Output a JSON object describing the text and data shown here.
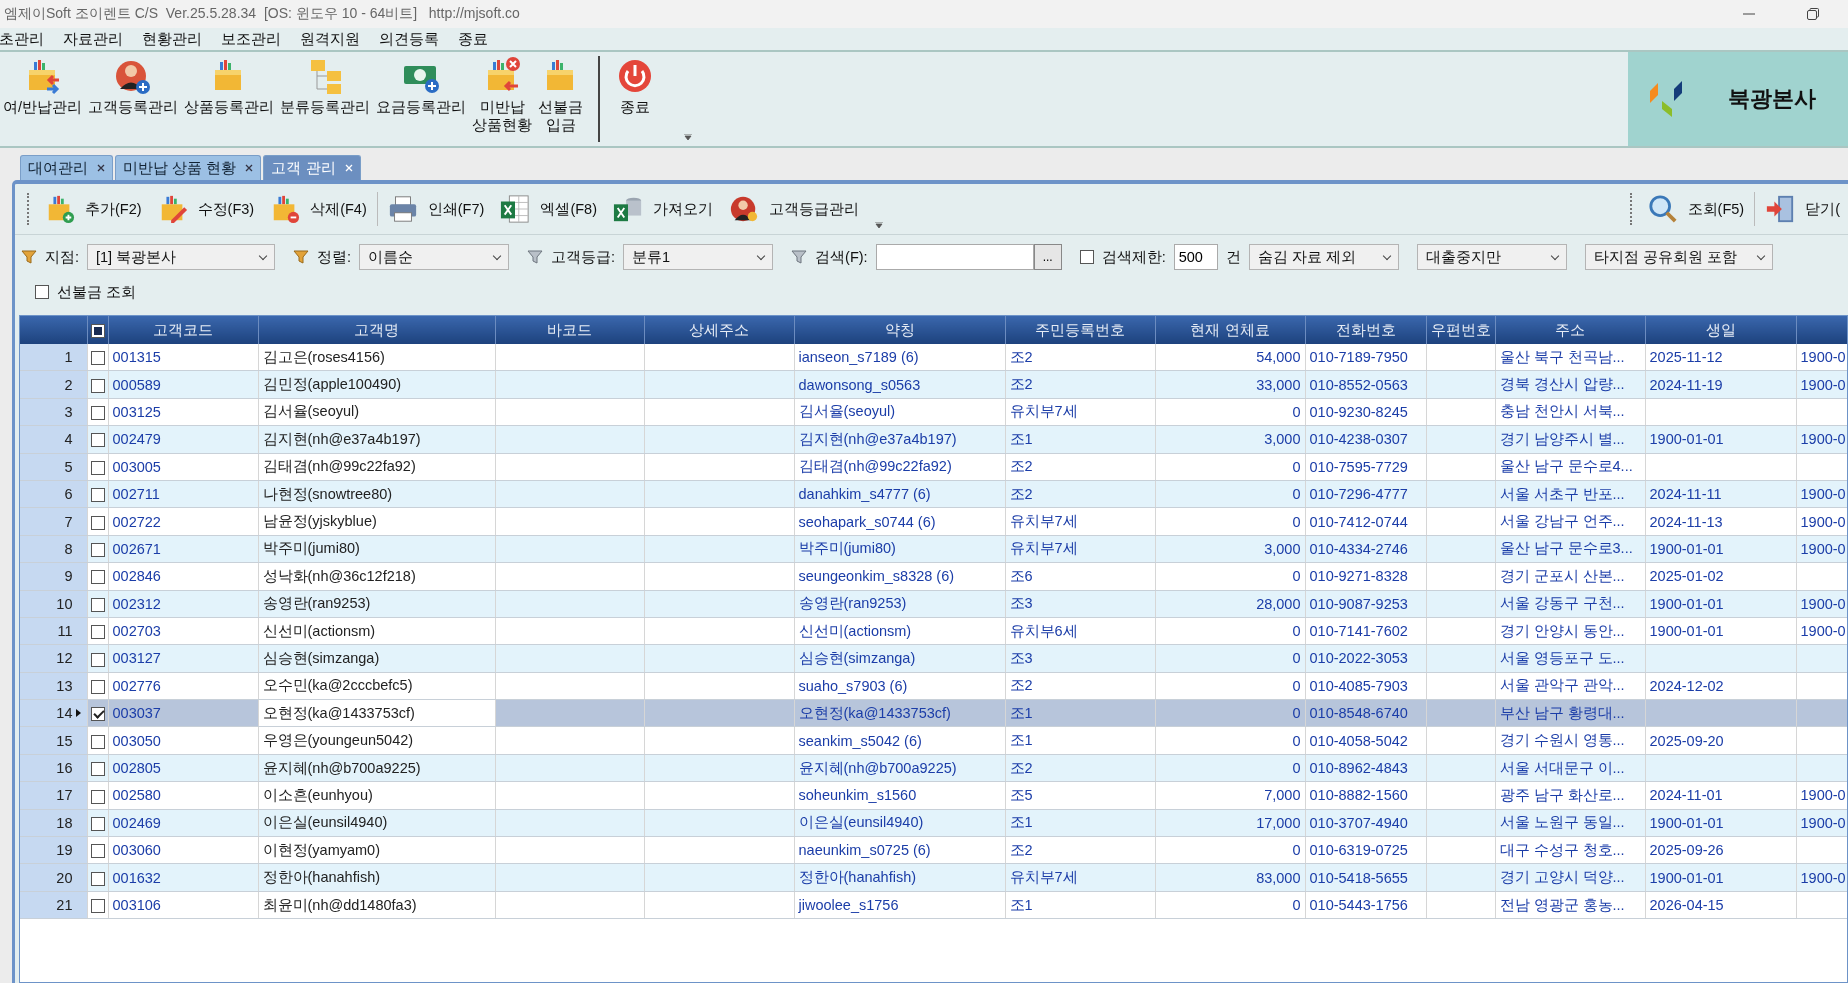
{
  "window": {
    "title": "엠제이Soft 조이렌트 C/S  Ver.25.5.28.34  [OS: 윈도우 10 - 64비트]   http://mjsoft.co"
  },
  "menu": [
    "초관리",
    "자료관리",
    "현황관리",
    "보조관리",
    "원격지원",
    "의견등록",
    "종료"
  ],
  "ribbon": [
    {
      "label": "여/반납관리"
    },
    {
      "label": "고객등록관리"
    },
    {
      "label": "상품등록관리"
    },
    {
      "label": "분류등록관리"
    },
    {
      "label": "요금등록관리"
    },
    {
      "label": "미반납\n상품현황"
    },
    {
      "label": "선불금\n입금"
    },
    {
      "label": "종료"
    }
  ],
  "branch_name": "북광본사",
  "tabs": [
    {
      "label": "대여관리",
      "selected": false
    },
    {
      "label": "미반납 상품 현황",
      "selected": false
    },
    {
      "label": "고객 관리",
      "selected": true
    }
  ],
  "toolbar": {
    "left": [
      "추가(F2)",
      "수정(F3)",
      "삭제(F4)",
      "인쇄(F7)",
      "엑셀(F8)",
      "가져오기",
      "고객등급관리"
    ],
    "right": [
      "조회(F5)",
      "닫기("
    ]
  },
  "filters": {
    "branch": {
      "label": "지점:",
      "value": "[1] 북광본사"
    },
    "sort": {
      "label": "정렬:",
      "value": "이름순"
    },
    "grade": {
      "label": "고객등급:",
      "value": "분류1"
    },
    "search": {
      "label": "검색(F):",
      "button": "..."
    },
    "limit": {
      "label": "검색제한:",
      "checked": false,
      "value": "500",
      "unit": "건"
    },
    "hidden": {
      "value": "숨김 자료 제외"
    },
    "loan": {
      "value": "대출중지만"
    },
    "shared": {
      "value": "타지점 공유회원 포함"
    },
    "prepaid": {
      "label": "선불금 조회",
      "checked": false
    }
  },
  "table": {
    "header_check_partial": true,
    "columns": [
      "고객코드",
      "고객명",
      "바코드",
      "상세주소",
      "약칭",
      "주민등록번호",
      "현재 연체료",
      "전화번호",
      "우편번호",
      "주소",
      "생일"
    ],
    "rows": [
      {
        "number": "1",
        "checked": false,
        "selected": false,
        "customer_code": "001315",
        "customer_name": "김고은(roses4156)",
        "nickname": "ianseon_s7189 (6)",
        "resident_no": "조2",
        "overdue_fee": "54,000",
        "phone": "010-7189-7950",
        "address": "울산 북구 천곡남...",
        "birthday": "2025-11-12",
        "column_14": "1900-0"
      },
      {
        "number": "2",
        "checked": false,
        "selected": false,
        "customer_code": "000589",
        "customer_name": "김민정(apple100490)",
        "nickname": "dawonsong_s0563",
        "resident_no": "조2",
        "overdue_fee": "33,000",
        "phone": "010-8552-0563",
        "address": "경북 경산시 압량...",
        "birthday": "2024-11-19",
        "column_14": "1900-0"
      },
      {
        "number": "3",
        "checked": false,
        "selected": false,
        "customer_code": "003125",
        "customer_name": "김서율(seoyul)",
        "nickname": "김서율(seoyul)",
        "resident_no": "유치부7세",
        "overdue_fee": "0",
        "phone": "010-9230-8245",
        "address": "충남 천안시 서북..."
      },
      {
        "number": "4",
        "checked": false,
        "selected": false,
        "customer_code": "002479",
        "customer_name": "김지현(nh@e37a4b197)",
        "nickname": "김지현(nh@e37a4b197)",
        "resident_no": "조1",
        "overdue_fee": "3,000",
        "phone": "010-4238-0307",
        "address": "경기 남양주시 별...",
        "birthday": "1900-01-01",
        "column_14": "1900-0"
      },
      {
        "number": "5",
        "checked": false,
        "selected": false,
        "customer_code": "003005",
        "customer_name": "김태겸(nh@99c22fa92)",
        "nickname": "김태겸(nh@99c22fa92)",
        "resident_no": "조2",
        "overdue_fee": "0",
        "phone": "010-7595-7729",
        "address": "울산 남구 문수로4..."
      },
      {
        "number": "6",
        "checked": false,
        "selected": false,
        "customer_code": "002711",
        "customer_name": "나현정(snowtree80)",
        "nickname": "danahkim_s4777 (6)",
        "resident_no": "조2",
        "overdue_fee": "0",
        "phone": "010-7296-4777",
        "address": "서울 서초구 반포...",
        "birthday": "2024-11-11",
        "column_14": "1900-0"
      },
      {
        "number": "7",
        "checked": false,
        "selected": false,
        "customer_code": "002722",
        "customer_name": "남윤정(yjskyblue)",
        "nickname": "seohapark_s0744 (6)",
        "resident_no": "유치부7세",
        "overdue_fee": "0",
        "phone": "010-7412-0744",
        "address": "서울 강남구 언주...",
        "birthday": "2024-11-13",
        "column_14": "1900-0"
      },
      {
        "number": "8",
        "checked": false,
        "selected": false,
        "customer_code": "002671",
        "customer_name": "박주미(jumi80)",
        "nickname": "박주미(jumi80)",
        "resident_no": "유치부7세",
        "overdue_fee": "3,000",
        "phone": "010-4334-2746",
        "address": "울산 남구 문수로3...",
        "birthday": "1900-01-01",
        "column_14": "1900-0"
      },
      {
        "number": "9",
        "checked": false,
        "selected": false,
        "customer_code": "002846",
        "customer_name": "성낙화(nh@36c12f218)",
        "nickname": "seungeonkim_s8328 (6)",
        "resident_no": "조6",
        "overdue_fee": "0",
        "phone": "010-9271-8328",
        "address": "경기 군포시 산본...",
        "birthday": "2025-01-02"
      },
      {
        "number": "10",
        "checked": false,
        "selected": false,
        "customer_code": "002312",
        "customer_name": "송영란(ran9253)",
        "nickname": "송영란(ran9253)",
        "resident_no": "조3",
        "overdue_fee": "28,000",
        "phone": "010-9087-9253",
        "address": "서울 강동구 구천...",
        "birthday": "1900-01-01",
        "column_14": "1900-0"
      },
      {
        "number": "11",
        "checked": false,
        "selected": false,
        "customer_code": "002703",
        "customer_name": "신선미(actionsm)",
        "nickname": "신선미(actionsm)",
        "resident_no": "유치부6세",
        "overdue_fee": "0",
        "phone": "010-7141-7602",
        "address": "경기 안양시 동안...",
        "birthday": "1900-01-01",
        "column_14": "1900-0"
      },
      {
        "number": "12",
        "checked": false,
        "selected": false,
        "customer_code": "003127",
        "customer_name": "심승현(simzanga)",
        "nickname": "심승현(simzanga)",
        "resident_no": "조3",
        "overdue_fee": "0",
        "phone": "010-2022-3053",
        "address": "서울 영등포구 도..."
      },
      {
        "number": "13",
        "checked": false,
        "selected": false,
        "customer_code": "002776",
        "customer_name": "오수민(ka@2cccbefc5)",
        "nickname": "suaho_s7903 (6)",
        "resident_no": "조2",
        "overdue_fee": "0",
        "phone": "010-4085-7903",
        "address": "서울 관악구 관악...",
        "birthday": "2024-12-02"
      },
      {
        "number": "14",
        "checked": true,
        "selected": true,
        "customer_code": "003037",
        "customer_name": "오현정(ka@1433753cf)",
        "nickname": "오현정(ka@1433753cf)",
        "resident_no": "조1",
        "overdue_fee": "0",
        "phone": "010-8548-6740",
        "address": "부산 남구 황령대..."
      },
      {
        "number": "15",
        "checked": false,
        "selected": false,
        "customer_code": "003050",
        "customer_name": "우영은(youngeun5042)",
        "nickname": "seankim_s5042 (6)",
        "resident_no": "조1",
        "overdue_fee": "0",
        "phone": "010-4058-5042",
        "address": "경기 수원시 영통...",
        "birthday": "2025-09-20"
      },
      {
        "number": "16",
        "checked": false,
        "selected": false,
        "customer_code": "002805",
        "customer_name": "윤지혜(nh@b700a9225)",
        "nickname": "윤지혜(nh@b700a9225)",
        "resident_no": "조2",
        "overdue_fee": "0",
        "phone": "010-8962-4843",
        "address": "서울 서대문구 이..."
      },
      {
        "number": "17",
        "checked": false,
        "selected": false,
        "customer_code": "002580",
        "customer_name": "이소흔(eunhyou)",
        "nickname": "soheunkim_s1560",
        "resident_no": "조5",
        "overdue_fee": "7,000",
        "phone": "010-8882-1560",
        "address": "광주 남구 화산로...",
        "birthday": "2024-11-01",
        "column_14": "1900-0"
      },
      {
        "number": "18",
        "checked": false,
        "selected": false,
        "customer_code": "002469",
        "customer_name": "이은실(eunsil4940)",
        "nickname": "이은실(eunsil4940)",
        "resident_no": "조1",
        "overdue_fee": "17,000",
        "phone": "010-3707-4940",
        "address": "서울 노원구 동일...",
        "birthday": "1900-01-01",
        "column_14": "1900-0"
      },
      {
        "number": "19",
        "checked": false,
        "selected": false,
        "customer_code": "003060",
        "customer_name": "이현정(yamyam0)",
        "nickname": "naeunkim_s0725 (6)",
        "resident_no": "조2",
        "overdue_fee": "0",
        "phone": "010-6319-0725",
        "address": "대구 수성구 청호...",
        "birthday": "2025-09-26"
      },
      {
        "number": "20",
        "checked": false,
        "selected": false,
        "customer_code": "001632",
        "customer_name": "정한아(hanahfish)",
        "nickname": "정한아(hanahfish)",
        "resident_no": "유치부7세",
        "overdue_fee": "83,000",
        "phone": "010-5418-5655",
        "address": "경기 고양시 덕양...",
        "birthday": "1900-01-01",
        "column_14": "1900-0"
      },
      {
        "number": "21",
        "checked": false,
        "selected": false,
        "customer_code": "003106",
        "customer_name": "최윤미(nh@dd1480fa3)",
        "nickname": "jiwoolee_s1756",
        "resident_no": "조1",
        "overdue_fee": "0",
        "phone": "010-5443-1756",
        "address": "전남 영광군 홍농...",
        "birthday": "2026-04-15"
      }
    ]
  }
}
